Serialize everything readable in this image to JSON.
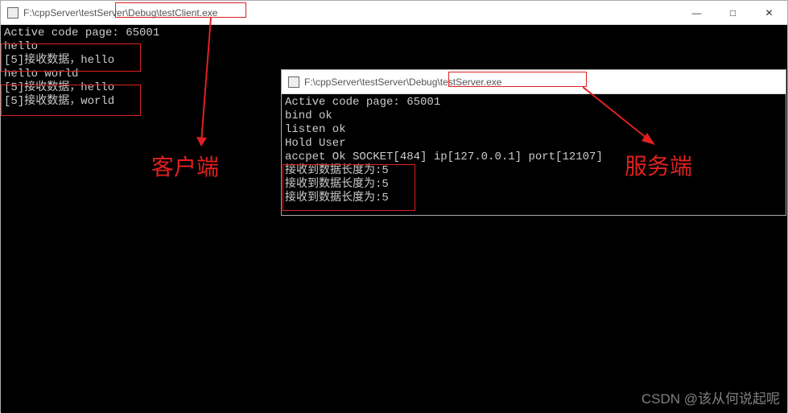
{
  "client_window": {
    "title": "F:\\cppServer\\testServer\\Debug\\testClient.exe",
    "lines": [
      "Active code page: 65001",
      "hello",
      "[5]接收数据，hello",
      "hello world",
      "[5]接收数据，hello",
      "[5]接收数据，world"
    ]
  },
  "server_window": {
    "title": "F:\\cppServer\\testServer\\Debug\\testServer.exe",
    "lines": [
      "Active code page: 65001",
      "bind ok",
      "listen ok",
      "Hold User",
      "accpet Ok SOCKET[484] ip[127.0.0.1] port[12107]",
      "接收到数据长度为:5",
      "接收到数据长度为:5",
      "接收到数据长度为:5"
    ]
  },
  "annotation": {
    "client_label": "客户端",
    "server_label": "服务端"
  },
  "window_buttons": {
    "min": "—",
    "max": "□",
    "close": "✕"
  },
  "watermark": "CSDN @该从何说起呢",
  "colors": {
    "red": "#e02020",
    "console_bg": "#000000",
    "console_fg": "#cccccc"
  }
}
